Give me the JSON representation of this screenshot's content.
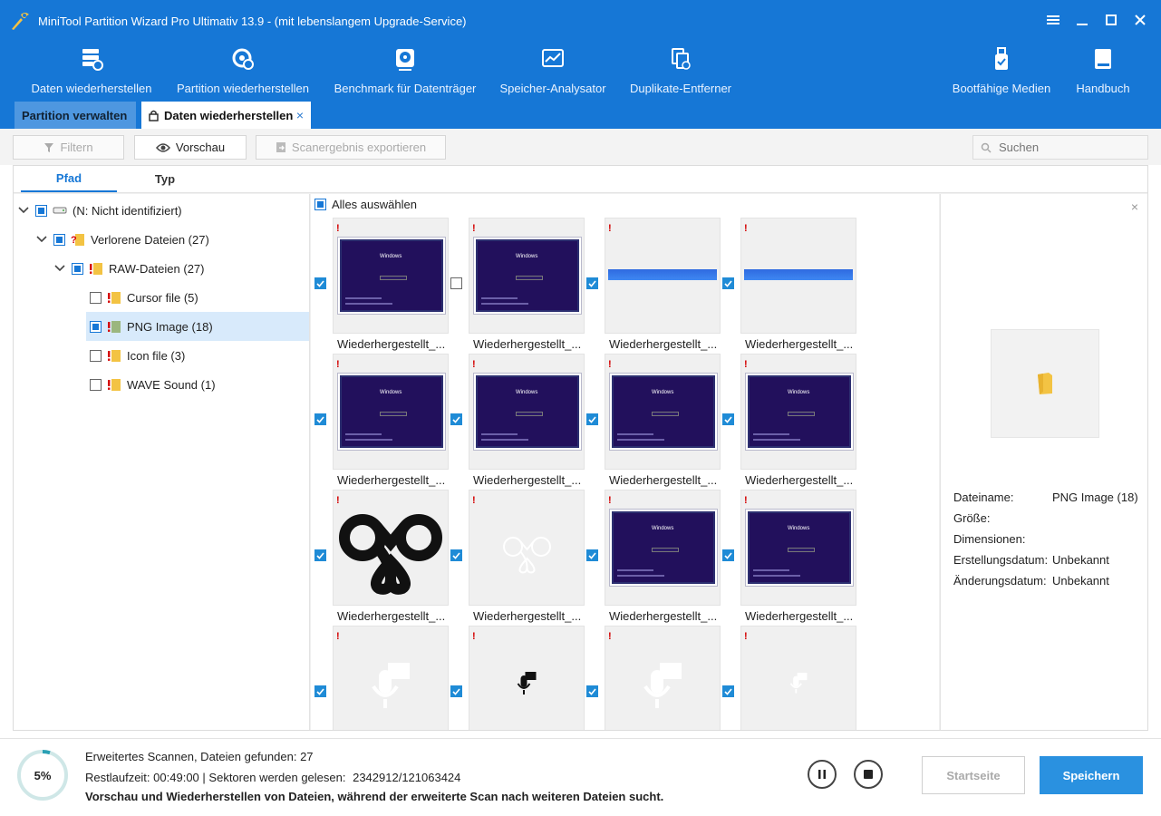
{
  "window": {
    "title": "MiniTool Partition Wizard Pro Ultimativ 13.9 - (mit lebenslangem Upgrade-Service)"
  },
  "toolbar_main": {
    "items": [
      {
        "label": "Daten wiederherstellen",
        "icon": "data-recovery-icon"
      },
      {
        "label": "Partition wiederherstellen",
        "icon": "partition-recovery-icon"
      },
      {
        "label": "Benchmark für Datenträger",
        "icon": "disk-benchmark-icon"
      },
      {
        "label": "Speicher-Analysator",
        "icon": "space-analyzer-icon"
      },
      {
        "label": "Duplikate-Entferner",
        "icon": "duplicate-remover-icon"
      },
      {
        "label": "Bootfähige Medien",
        "icon": "bootable-media-icon"
      },
      {
        "label": "Handbuch",
        "icon": "manual-book-icon"
      }
    ]
  },
  "tabs": {
    "manage": "Partition verwalten",
    "recover": "Daten wiederherstellen",
    "close_symbol": "×"
  },
  "actions": {
    "filter": "Filtern",
    "preview": "Vorschau",
    "export": "Scanergebnis exportieren",
    "search_placeholder": "Suchen"
  },
  "view_tabs": {
    "path": "Pfad",
    "type": "Typ",
    "active": "path"
  },
  "tree": {
    "root": "(N: Nicht identifiziert)",
    "lost": "Verlorene Dateien (27)",
    "raw": "RAW-Dateien (27)",
    "children": [
      {
        "label": "Cursor file (5)",
        "checked": false
      },
      {
        "label": "PNG Image (18)",
        "checked": true,
        "selected": true
      },
      {
        "label": "Icon file (3)",
        "checked": false
      },
      {
        "label": "WAVE Sound (1)",
        "checked": false
      }
    ]
  },
  "grid": {
    "select_all": "Alles auswählen",
    "warning_mark": "!",
    "window_caption": "Windows",
    "files": [
      {
        "name": "Wiederhergestellt_...",
        "checked": true,
        "thumb": "windows-setup"
      },
      {
        "name": "Wiederhergestellt_...",
        "checked": false,
        "thumb": "windows-setup"
      },
      {
        "name": "Wiederhergestellt_...",
        "checked": true,
        "thumb": "blue-bar"
      },
      {
        "name": "Wiederhergestellt_...",
        "checked": true,
        "thumb": "blue-bar"
      },
      {
        "name": "Wiederhergestellt_...",
        "checked": true,
        "thumb": "windows-setup"
      },
      {
        "name": "Wiederhergestellt_...",
        "checked": true,
        "thumb": "windows-setup"
      },
      {
        "name": "Wiederhergestellt_...",
        "checked": true,
        "thumb": "windows-setup"
      },
      {
        "name": "Wiederhergestellt_...",
        "checked": true,
        "thumb": "windows-setup"
      },
      {
        "name": "Wiederhergestellt_...",
        "checked": true,
        "thumb": "knot-logo-black"
      },
      {
        "name": "Wiederhergestellt_...",
        "checked": true,
        "thumb": "knot-logo-white"
      },
      {
        "name": "Wiederhergestellt_...",
        "checked": true,
        "thumb": "windows-setup"
      },
      {
        "name": "Wiederhergestellt_...",
        "checked": true,
        "thumb": "windows-setup"
      },
      {
        "name": "",
        "checked": true,
        "thumb": "chat-mic-white"
      },
      {
        "name": "",
        "checked": true,
        "thumb": "chat-mic-black"
      },
      {
        "name": "",
        "checked": true,
        "thumb": "chat-mic-white"
      },
      {
        "name": "",
        "checked": true,
        "thumb": "chat-mic-small"
      }
    ]
  },
  "details": {
    "close_symbol": "×",
    "rows": [
      {
        "key": "Dateiname:",
        "value": "PNG Image (18)"
      },
      {
        "key": "Größe:",
        "value": ""
      },
      {
        "key": "Dimensionen:",
        "value": ""
      },
      {
        "key": "Erstellungsdatum:",
        "value": "Unbekannt"
      },
      {
        "key": "Änderungsdatum:",
        "value": "Unbekannt"
      }
    ]
  },
  "status": {
    "progress_percent": 5,
    "progress_text": "5%",
    "line1_label": "Erweitertes Scannen, Dateien gefunden:",
    "files_found": "27",
    "remaining_label": "Restlaufzeit:",
    "remaining": "00:49:00",
    "separator": "|",
    "sectors_label": "Sektoren werden gelesen:",
    "sectors": "2342912/121063424",
    "message": "Vorschau und Wiederherstellen von Dateien, während der erweiterte Scan nach weiteren Dateien sucht.",
    "home_button": "Startseite",
    "save_button": "Speichern"
  },
  "colors": {
    "header": "#1677d6",
    "accent": "#2a91e0",
    "warning": "#d40000"
  }
}
